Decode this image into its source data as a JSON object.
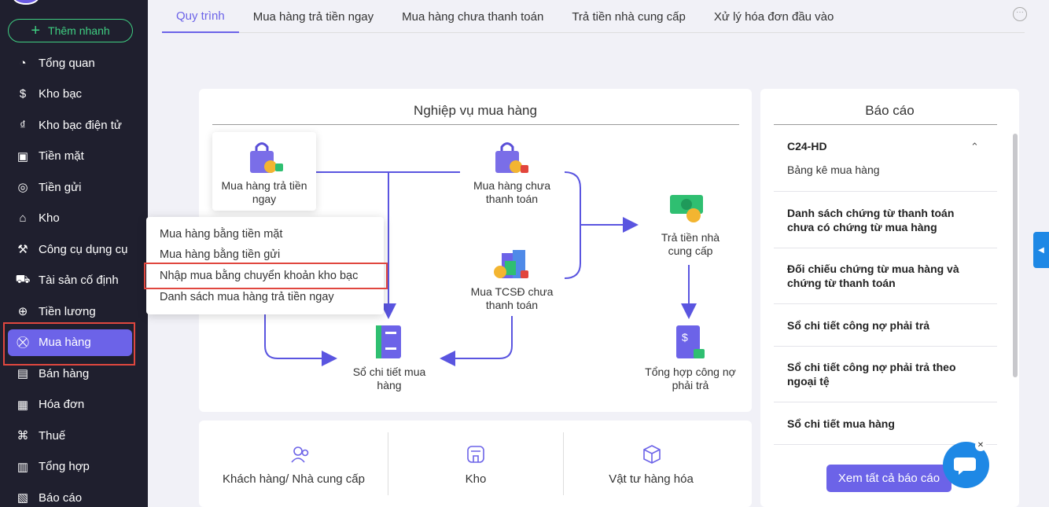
{
  "sidebar": {
    "quick_add": "Thêm nhanh",
    "items": [
      {
        "label": "Tổng quan",
        "icon": "pie-chart-icon"
      },
      {
        "label": "Kho bạc",
        "icon": "dollar-icon"
      },
      {
        "label": "Kho bạc điện tử",
        "icon": "digital-dollar-icon"
      },
      {
        "label": "Tiền mặt",
        "icon": "cash-icon"
      },
      {
        "label": "Tiền gửi",
        "icon": "deposit-icon"
      },
      {
        "label": "Kho",
        "icon": "warehouse-icon"
      },
      {
        "label": "Công cụ dụng cụ",
        "icon": "tools-icon"
      },
      {
        "label": "Tài sản cố định",
        "icon": "truck-icon"
      },
      {
        "label": "Tiền lương",
        "icon": "salary-icon"
      },
      {
        "label": "Mua hàng",
        "icon": "cart-icon"
      },
      {
        "label": "Bán hàng",
        "icon": "shop-icon"
      },
      {
        "label": "Hóa đơn",
        "icon": "invoice-icon"
      },
      {
        "label": "Thuế",
        "icon": "bank-icon"
      },
      {
        "label": "Tổng hợp",
        "icon": "summary-icon"
      },
      {
        "label": "Báo cáo",
        "icon": "report-icon"
      }
    ]
  },
  "tabs": [
    "Quy trình",
    "Mua hàng trả tiền ngay",
    "Mua hàng chưa thanh toán",
    "Trả tiền nhà cung cấp",
    "Xử lý hóa đơn đầu vào"
  ],
  "flow": {
    "title": "Nghiệp vụ mua hàng",
    "nodes": {
      "pay_now": "Mua hàng trả tiền ngay",
      "unpaid": "Mua hàng chưa thanh toán",
      "fixed_asset": "Mua TCSĐ chưa thanh toán",
      "pay_supplier": "Trả tiền nhà cung cấp",
      "ledger": "Sổ chi tiết mua hàng",
      "payable": "Tổng hợp công nợ phải trả"
    },
    "dropdown": [
      "Mua hàng bằng tiền mặt",
      "Mua hàng bằng tiền gửi",
      "Nhập mua bằng chuyển khoản kho bạc",
      "Danh sách mua hàng trả tiền ngay"
    ]
  },
  "bottom": [
    "Khách hàng/ Nhà cung cấp",
    "Kho",
    "Vật tư hàng hóa"
  ],
  "reports": {
    "title": "Báo cáo",
    "group_code": "C24-HD",
    "group_sub": "Bảng kê mua hàng",
    "items": [
      "Danh sách chứng từ thanh toán chưa có chứng từ mua hàng",
      "Đối chiếu chứng từ mua hàng và chứng từ thanh toán",
      "Sổ chi tiết công nợ phải trả",
      "Sổ chi tiết công nợ phải trả theo ngoại tệ",
      "Sổ chi tiết mua hàng"
    ],
    "view_all": "Xem tất cả báo cáo"
  },
  "colors": {
    "accent": "#6c63e8",
    "highlight": "#e0473f",
    "sidebar": "#1f1f2e"
  }
}
